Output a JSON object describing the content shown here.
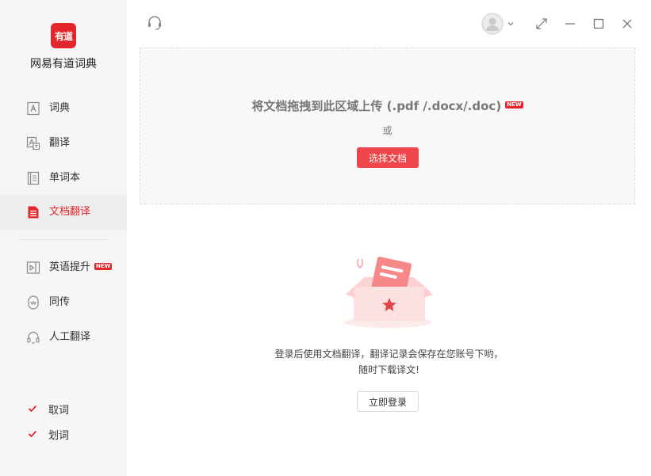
{
  "app": {
    "logo_text": "有道",
    "name": "网易有道词典"
  },
  "sidebar": {
    "items": [
      {
        "label": "词典",
        "icon": "dictionary-icon"
      },
      {
        "label": "翻译",
        "icon": "translate-icon"
      },
      {
        "label": "单词本",
        "icon": "wordbook-icon"
      },
      {
        "label": "文档翻译",
        "icon": "document-icon",
        "active": true
      },
      {
        "label": "英语提升",
        "icon": "video-icon",
        "badge": "NEW"
      },
      {
        "label": "同传",
        "icon": "simultaneous-icon"
      },
      {
        "label": "人工翻译",
        "icon": "headset-icon"
      }
    ],
    "checks": [
      {
        "label": "取词",
        "checked": true
      },
      {
        "label": "划词",
        "checked": true
      }
    ]
  },
  "upload": {
    "title": "将文档拖拽到此区域上传 (.pdf /.docx/.doc)",
    "badge": "NEW",
    "or_text": "或",
    "button": "选择文档"
  },
  "empty": {
    "line1": "登录后使用文档翻译，翻译记录会保存在您账号下哟，",
    "line2": "随时下载译文!",
    "login_button": "立即登录"
  },
  "colors": {
    "accent": "#e4262b",
    "button": "#f0454a",
    "sidebar_bg": "#f6f6f6"
  }
}
